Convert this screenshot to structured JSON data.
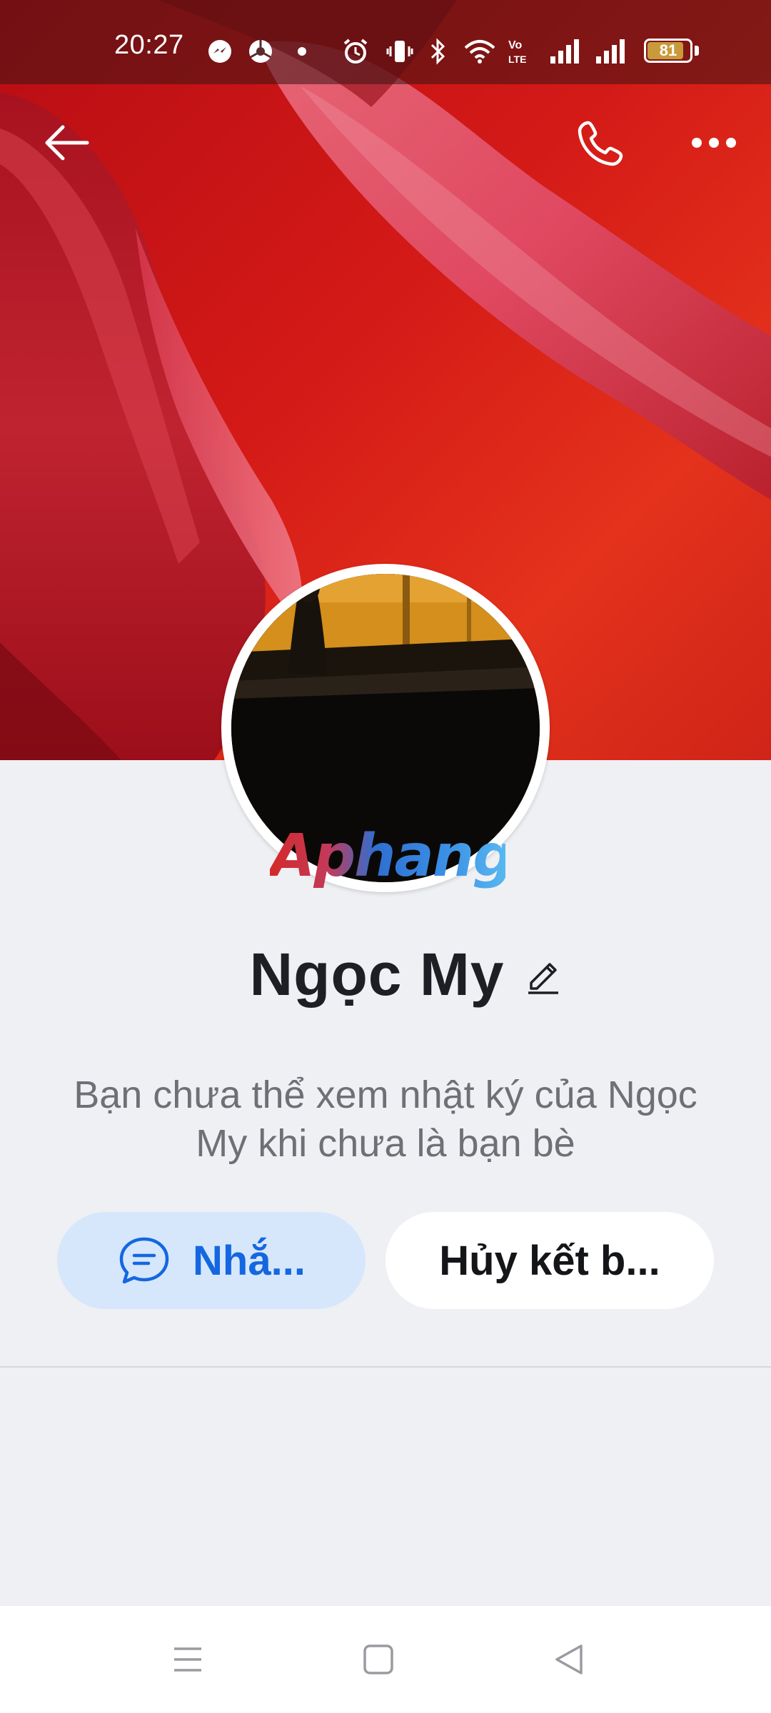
{
  "status_bar": {
    "time": "20:27",
    "battery_level": "81",
    "icons": [
      "messenger-icon",
      "browser-icon",
      "notification-dot-icon",
      "alarm-icon",
      "vibrate-icon",
      "bluetooth-icon",
      "wifi-icon",
      "volte-icon",
      "signal-icon",
      "signal-icon"
    ]
  },
  "header": {
    "back_icon": "arrow-left-icon",
    "call_icon": "phone-icon",
    "more_icon": "ellipsis-icon"
  },
  "profile": {
    "name": "Ngọc My",
    "edit_icon": "pencil-icon",
    "watermark": "Aphang",
    "privacy_note": "Bạn chưa thể xem nhật ký của Ngọc My khi chưa là bạn bè"
  },
  "actions": {
    "message_label": "Nhắ...",
    "message_icon": "chat-bubble-icon",
    "unfriend_label": "Hủy kết b..."
  },
  "nav_bar": {
    "icons": [
      "menu-icon",
      "home-square-icon",
      "back-triangle-icon"
    ]
  },
  "colors": {
    "accent": "#1467e0",
    "accent_bg": "#d6e7fb",
    "page_bg": "#eff0f4"
  }
}
